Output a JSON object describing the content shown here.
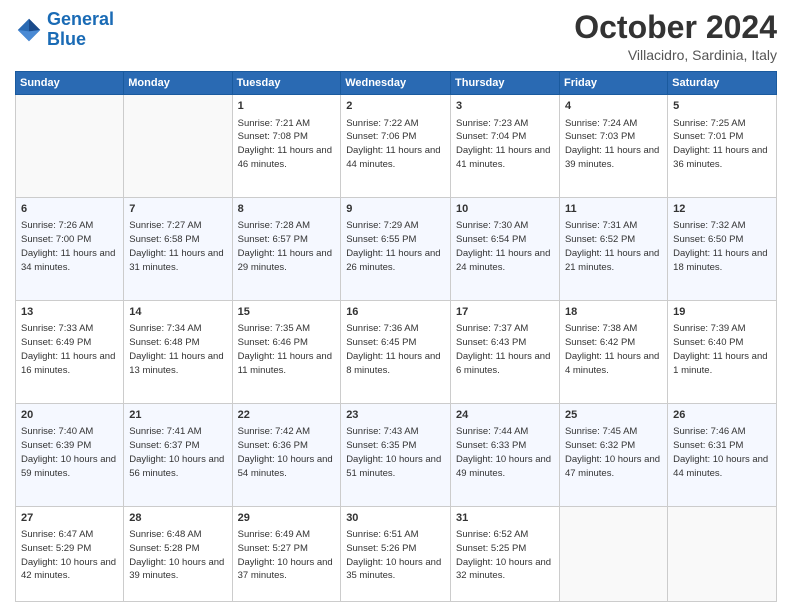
{
  "header": {
    "logo_line1": "General",
    "logo_line2": "Blue",
    "month": "October 2024",
    "location": "Villacidro, Sardinia, Italy"
  },
  "days_of_week": [
    "Sunday",
    "Monday",
    "Tuesday",
    "Wednesday",
    "Thursday",
    "Friday",
    "Saturday"
  ],
  "weeks": [
    [
      {
        "day": "",
        "text": ""
      },
      {
        "day": "",
        "text": ""
      },
      {
        "day": "1",
        "text": "Sunrise: 7:21 AM\nSunset: 7:08 PM\nDaylight: 11 hours and 46 minutes."
      },
      {
        "day": "2",
        "text": "Sunrise: 7:22 AM\nSunset: 7:06 PM\nDaylight: 11 hours and 44 minutes."
      },
      {
        "day": "3",
        "text": "Sunrise: 7:23 AM\nSunset: 7:04 PM\nDaylight: 11 hours and 41 minutes."
      },
      {
        "day": "4",
        "text": "Sunrise: 7:24 AM\nSunset: 7:03 PM\nDaylight: 11 hours and 39 minutes."
      },
      {
        "day": "5",
        "text": "Sunrise: 7:25 AM\nSunset: 7:01 PM\nDaylight: 11 hours and 36 minutes."
      }
    ],
    [
      {
        "day": "6",
        "text": "Sunrise: 7:26 AM\nSunset: 7:00 PM\nDaylight: 11 hours and 34 minutes."
      },
      {
        "day": "7",
        "text": "Sunrise: 7:27 AM\nSunset: 6:58 PM\nDaylight: 11 hours and 31 minutes."
      },
      {
        "day": "8",
        "text": "Sunrise: 7:28 AM\nSunset: 6:57 PM\nDaylight: 11 hours and 29 minutes."
      },
      {
        "day": "9",
        "text": "Sunrise: 7:29 AM\nSunset: 6:55 PM\nDaylight: 11 hours and 26 minutes."
      },
      {
        "day": "10",
        "text": "Sunrise: 7:30 AM\nSunset: 6:54 PM\nDaylight: 11 hours and 24 minutes."
      },
      {
        "day": "11",
        "text": "Sunrise: 7:31 AM\nSunset: 6:52 PM\nDaylight: 11 hours and 21 minutes."
      },
      {
        "day": "12",
        "text": "Sunrise: 7:32 AM\nSunset: 6:50 PM\nDaylight: 11 hours and 18 minutes."
      }
    ],
    [
      {
        "day": "13",
        "text": "Sunrise: 7:33 AM\nSunset: 6:49 PM\nDaylight: 11 hours and 16 minutes."
      },
      {
        "day": "14",
        "text": "Sunrise: 7:34 AM\nSunset: 6:48 PM\nDaylight: 11 hours and 13 minutes."
      },
      {
        "day": "15",
        "text": "Sunrise: 7:35 AM\nSunset: 6:46 PM\nDaylight: 11 hours and 11 minutes."
      },
      {
        "day": "16",
        "text": "Sunrise: 7:36 AM\nSunset: 6:45 PM\nDaylight: 11 hours and 8 minutes."
      },
      {
        "day": "17",
        "text": "Sunrise: 7:37 AM\nSunset: 6:43 PM\nDaylight: 11 hours and 6 minutes."
      },
      {
        "day": "18",
        "text": "Sunrise: 7:38 AM\nSunset: 6:42 PM\nDaylight: 11 hours and 4 minutes."
      },
      {
        "day": "19",
        "text": "Sunrise: 7:39 AM\nSunset: 6:40 PM\nDaylight: 11 hours and 1 minute."
      }
    ],
    [
      {
        "day": "20",
        "text": "Sunrise: 7:40 AM\nSunset: 6:39 PM\nDaylight: 10 hours and 59 minutes."
      },
      {
        "day": "21",
        "text": "Sunrise: 7:41 AM\nSunset: 6:37 PM\nDaylight: 10 hours and 56 minutes."
      },
      {
        "day": "22",
        "text": "Sunrise: 7:42 AM\nSunset: 6:36 PM\nDaylight: 10 hours and 54 minutes."
      },
      {
        "day": "23",
        "text": "Sunrise: 7:43 AM\nSunset: 6:35 PM\nDaylight: 10 hours and 51 minutes."
      },
      {
        "day": "24",
        "text": "Sunrise: 7:44 AM\nSunset: 6:33 PM\nDaylight: 10 hours and 49 minutes."
      },
      {
        "day": "25",
        "text": "Sunrise: 7:45 AM\nSunset: 6:32 PM\nDaylight: 10 hours and 47 minutes."
      },
      {
        "day": "26",
        "text": "Sunrise: 7:46 AM\nSunset: 6:31 PM\nDaylight: 10 hours and 44 minutes."
      }
    ],
    [
      {
        "day": "27",
        "text": "Sunrise: 6:47 AM\nSunset: 5:29 PM\nDaylight: 10 hours and 42 minutes."
      },
      {
        "day": "28",
        "text": "Sunrise: 6:48 AM\nSunset: 5:28 PM\nDaylight: 10 hours and 39 minutes."
      },
      {
        "day": "29",
        "text": "Sunrise: 6:49 AM\nSunset: 5:27 PM\nDaylight: 10 hours and 37 minutes."
      },
      {
        "day": "30",
        "text": "Sunrise: 6:51 AM\nSunset: 5:26 PM\nDaylight: 10 hours and 35 minutes."
      },
      {
        "day": "31",
        "text": "Sunrise: 6:52 AM\nSunset: 5:25 PM\nDaylight: 10 hours and 32 minutes."
      },
      {
        "day": "",
        "text": ""
      },
      {
        "day": "",
        "text": ""
      }
    ]
  ]
}
